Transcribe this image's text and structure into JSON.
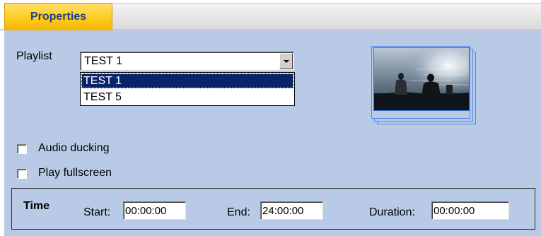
{
  "tabs": {
    "properties_label": "Properties"
  },
  "playlist": {
    "label": "Playlist",
    "selected": "TEST 1",
    "options": [
      "TEST 1",
      "TEST 5"
    ]
  },
  "options": {
    "audio_ducking_label": "Audio ducking",
    "audio_ducking_checked": false,
    "play_fullscreen_label": "Play fullscreen",
    "play_fullscreen_checked": false
  },
  "time": {
    "heading": "Time",
    "start_label": "Start:",
    "start_value": "00:00:00",
    "end_label": "End:",
    "end_value": "24:00:00",
    "duration_label": "Duration:",
    "duration_value": "00:00:00"
  },
  "colors": {
    "panel_bg": "#b9cae6",
    "tab_active": "#ffcb1f",
    "tab_text": "#1f3f83",
    "selection": "#0a246a"
  },
  "icons": {
    "combo_arrow": "chevron-down-icon",
    "thumbnail": "playlist-thumbnail"
  }
}
